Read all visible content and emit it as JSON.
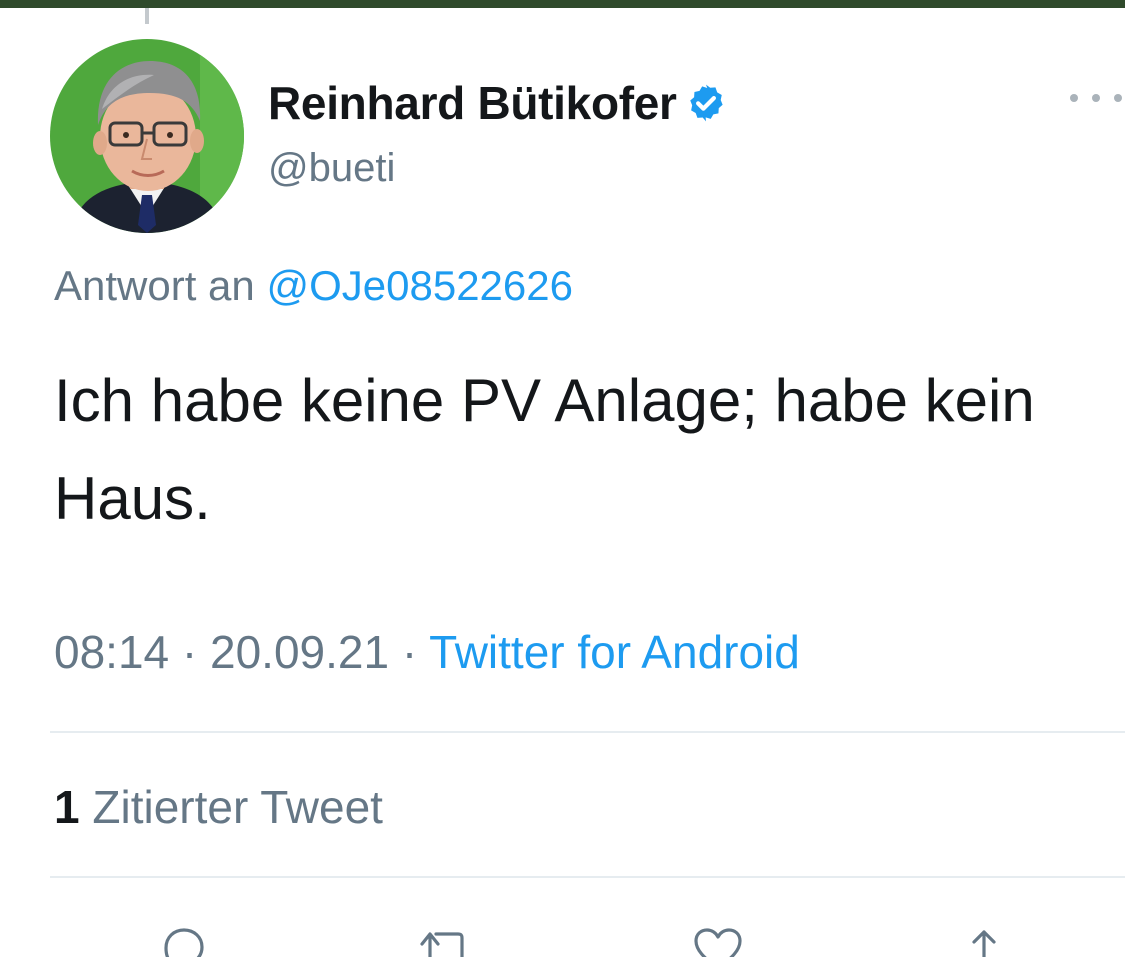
{
  "author": {
    "display_name": "Reinhard Bütikofer",
    "handle": "@bueti",
    "verified": true,
    "avatar": "profile-photo"
  },
  "reply": {
    "prefix": "Antwort an",
    "to": "@OJe08522626"
  },
  "tweet": {
    "text": "Ich habe keine PV Anlage; habe kein Haus.",
    "time": "08:14",
    "separator": "·",
    "date": "20.09.21",
    "source": "Twitter for Android"
  },
  "engagement": {
    "quote_count": "1",
    "quote_label": "Zitierter Tweet"
  },
  "icons": {
    "more": "more-icon",
    "verified": "verified-badge-icon",
    "reply": "reply-icon",
    "retweet": "retweet-icon",
    "like": "heart-icon",
    "share": "share-icon"
  },
  "colors": {
    "link": "#1d9bf0",
    "secondary_text": "#657786",
    "primary_text": "#14171a",
    "top_bar": "#2f4a2b"
  }
}
